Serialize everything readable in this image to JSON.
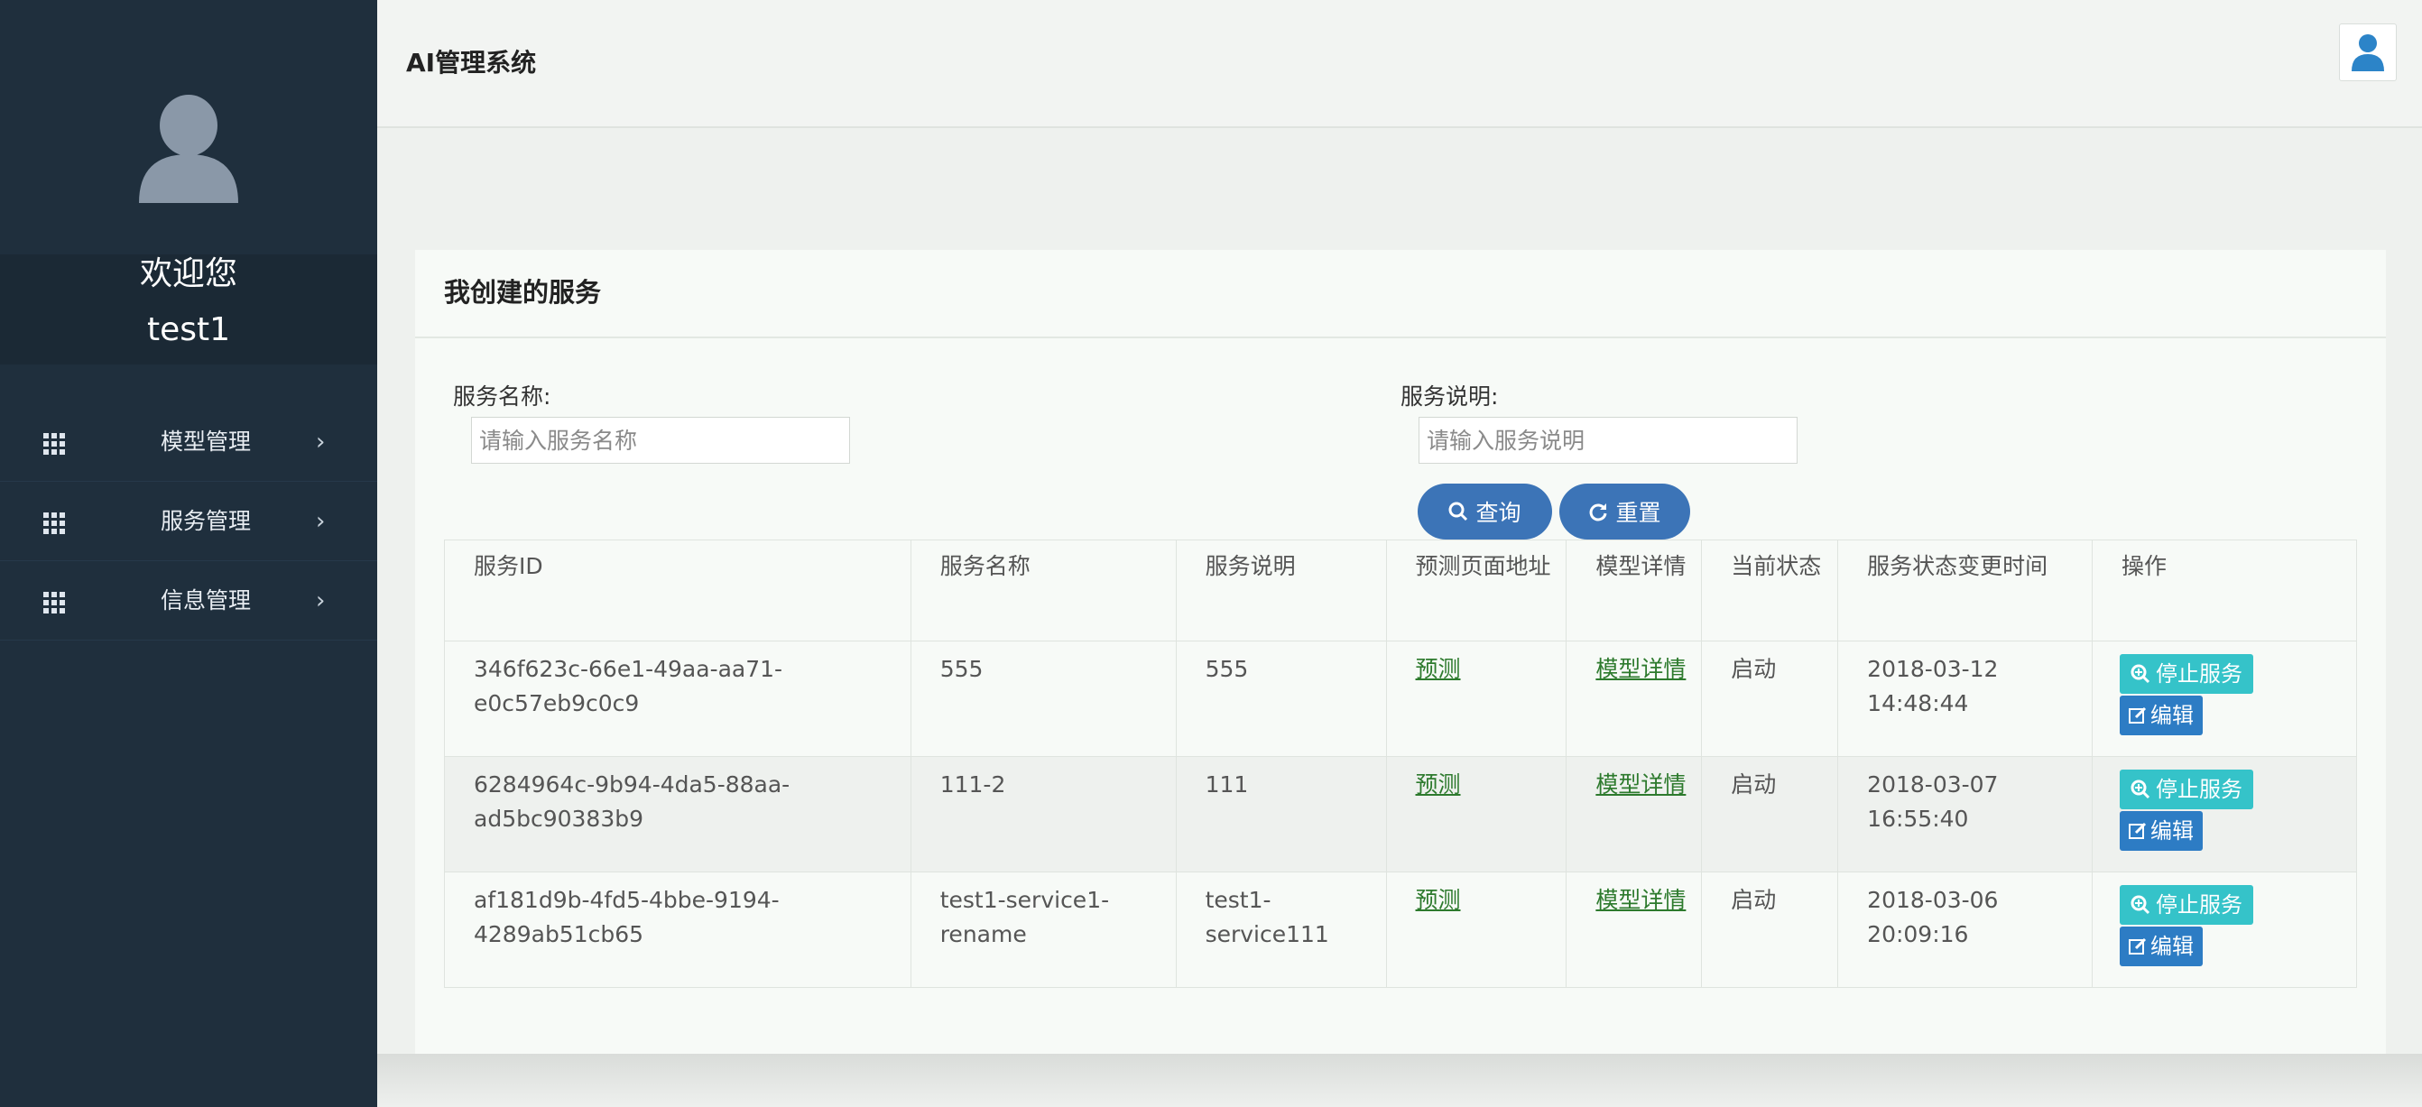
{
  "sidebar": {
    "welcome": "欢迎您",
    "username": "test1",
    "items": [
      {
        "label": "模型管理",
        "icon": "grid-icon"
      },
      {
        "label": "服务管理",
        "icon": "grid-icon"
      },
      {
        "label": "信息管理",
        "icon": "grid-icon"
      }
    ],
    "chevron": "›"
  },
  "header": {
    "title": "AI管理系统",
    "user_icon": "user-icon"
  },
  "panel": {
    "title": "我创建的服务",
    "filters": {
      "name_label": "服务名称:",
      "name_placeholder": "请输入服务名称",
      "desc_label": "服务说明:",
      "desc_placeholder": "请输入服务说明"
    },
    "buttons": {
      "search": "查询",
      "reset": "重置"
    }
  },
  "table": {
    "headers": [
      "服务ID",
      "服务名称",
      "服务说明",
      "预测页面地址",
      "模型详情",
      "当前状态",
      "服务状态变更时间",
      "操作"
    ],
    "rows": [
      {
        "id": "346f623c-66e1-49aa-aa71-e0c57eb9c0c9",
        "name": "555",
        "desc": "555",
        "predict": "预测",
        "model": "模型详情",
        "status": "启动",
        "time": "2018-03-12 14:48:44",
        "stop": "停止服务",
        "edit": "编辑"
      },
      {
        "id": "6284964c-9b94-4da5-88aa-ad5bc90383b9",
        "name": "111-2",
        "desc": "111",
        "predict": "预测",
        "model": "模型详情",
        "status": "启动",
        "time": "2018-03-07 16:55:40",
        "stop": "停止服务",
        "edit": "编辑"
      },
      {
        "id": "af181d9b-4fd5-4bbe-9194-4289ab51cb65",
        "name": "test1-service1-rename",
        "desc": "test1-service111",
        "predict": "预测",
        "model": "模型详情",
        "status": "启动",
        "time": "2018-03-06 20:09:16",
        "stop": "停止服务",
        "edit": "编辑"
      }
    ]
  },
  "colors": {
    "sidebar_bg": "#1f2f3d",
    "primary_button": "#3c74b7",
    "stop_button": "#35c3c9",
    "edit_button": "#2d7cc4",
    "link": "#2d7a2d"
  }
}
